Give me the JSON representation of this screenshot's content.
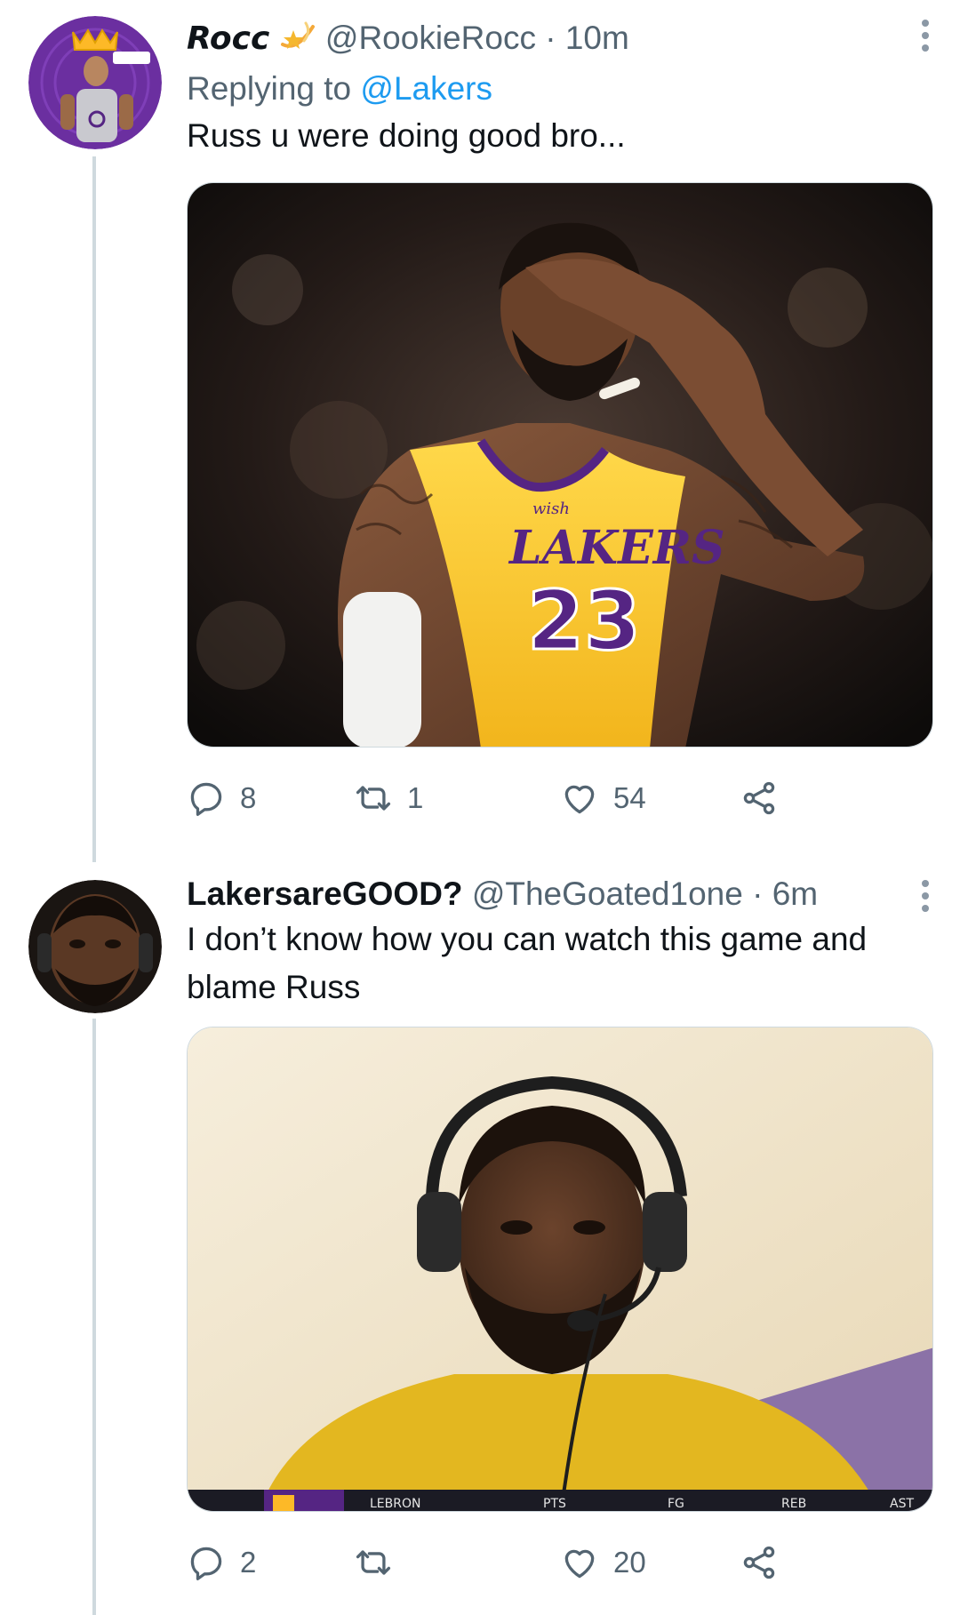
{
  "tweets": [
    {
      "display_name": "Rocc",
      "handle": "@RookieRocc",
      "separator": "·",
      "time": "10m",
      "replying_prefix": "Replying to",
      "replying_to": "@Lakers",
      "text": "Russ u were doing good bro...",
      "image_text": {
        "sponsor": "wish",
        "team": "LAKERS",
        "number": "23"
      },
      "stats": {
        "replies": "8",
        "retweets": "1",
        "likes": "54"
      }
    },
    {
      "display_name": "LakersareGOOD?",
      "handle": "@TheGoated1one",
      "separator": "·",
      "time": "6m",
      "text": "I don’t know how you can watch this game and blame Russ",
      "image_text": {
        "lower_third": [
          "LEBRON",
          "PTS",
          "FG",
          "REB",
          "AST"
        ]
      },
      "stats": {
        "replies": "2",
        "retweets": "",
        "likes": "20"
      }
    }
  ],
  "colors": {
    "link": "#1d9bf0",
    "muted": "#536471",
    "thread_line": "#cfd9de",
    "lakers_gold": "#fdb927",
    "lakers_purple": "#552583"
  },
  "icons": [
    "more-icon",
    "star-emoji-icon",
    "reply-icon",
    "retweet-icon",
    "like-icon",
    "share-icon"
  ]
}
